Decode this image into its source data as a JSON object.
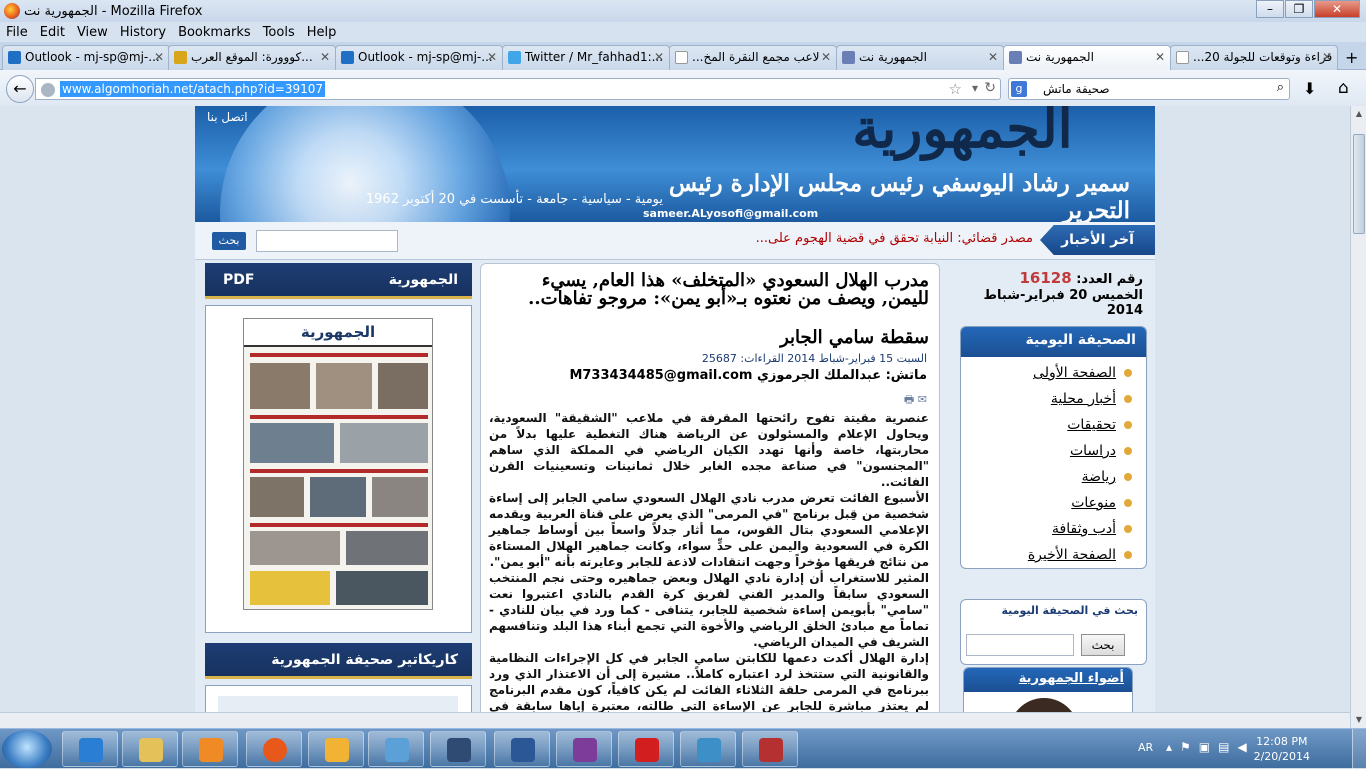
{
  "window": {
    "title": "الجمهورية نت - Mozilla Firefox"
  },
  "menu": [
    "File",
    "Edit",
    "View",
    "History",
    "Bookmarks",
    "Tools",
    "Help"
  ],
  "tabs": [
    {
      "label": "Outlook - mj-sp@mj-...",
      "icon_color": "#1f6fc5"
    },
    {
      "label": "كووورة: الموقع العرب...",
      "icon_color": "#d9a51b"
    },
    {
      "label": "Outlook - mj-sp@mj-...",
      "icon_color": "#1f6fc5"
    },
    {
      "label": "Twitter / Mr_fahhad1:...",
      "icon_color": "#41a6e8"
    },
    {
      "label": "...لاعب مجمع النقرة المخ",
      "icon_color": "#ffffff"
    },
    {
      "label": "الجمهورية نت",
      "icon_color": "#6a7fb5"
    },
    {
      "label": "الجمهورية نت",
      "icon_color": "#6a7fb5"
    },
    {
      "label": "...قراءة وتوقعات للجولة 20",
      "icon_color": "#ffffff"
    }
  ],
  "nav": {
    "url": "www.algomhoriah.net/atach.php?id=39107",
    "search_engine": "g",
    "search_query": "صحيفة ماتش"
  },
  "site": {
    "logo": "الجمهورية",
    "editor_line": "سمير رشاد اليوسفي رئيس مجلس الإدارة رئيس التحرير",
    "tagline": "يومية - سياسية - جامعة - تأسست في 20 أكتوبر 1962",
    "email": "sameer.ALyosofi@gmail.com",
    "contact": "اتصل بنا",
    "ticker_label": "آخر الأخبار",
    "ticker_text": "مصدر قضائي: النيابة تحقق في قضية الهجوم على...",
    "search_button": "بحث"
  },
  "left": {
    "pdf_title": "الجمهورية",
    "pdf_label": "PDF",
    "paper_masthead": "الجمهورية",
    "caricature_title": "كاريكاتير صحيفة الجمهورية"
  },
  "article": {
    "title": "مدرب الهلال السعودي «المتخلف» هذا العام, يسيء لليمن, ويصف من نعتوه بـ«أبو يمن»: مروجو تفاهات..",
    "subtitle": "سقطة سامي الجابر",
    "date_line": "السبت 15 فبراير-شباط 2014 القراءات: 25687",
    "author_label": "ماتش: عبدالملك الجرموزي",
    "author_email": "M733434485@gmail.com",
    "paragraphs": [
      "عنصرية مقيتة تفوح رائحتها المقرفة في ملاعب \"الشقيقة\" السعودية، ويحاول الإعلام والمسئولون عن الرياضة هناك التغطية عليها بدلاً من محاربتها، خاصة وأنها تهدد الكيان الرياضي في المملكة الذي ساهم \"المجنسون\" في صناعة مجده الغابر خلال ثمانينات وتسعينيات القرن الفائت..",
      "الأسبوع الفائت تعرض مدرب نادي الهلال السعودي سامي الجابر إلى إساءة شخصية من قِبل برنامج \"في المرمى\" الذي يعرض على قناة العربية ويقدمه الإعلامي السعودي بتال القوس، مما أثار جدلاً واسعاً بين أوساط جماهير الكرة في السعودية واليمن على حدٍّ سواء، وكانت جماهير الهلال المستاءة من نتائج فريقها مؤخراً وجهت انتقادات لاذعة للجابر وعايرته بأنه \"أبو يمن\".",
      "المثير للاستغراب أن إدارة نادي الهلال وبعض جماهيره وحتى نجم المنتخب السعودي سابقاً والمدير الفني لفريق كرة القدم بالنادي اعتبروا نعت \"سامي\" بأبويمن إساءة شخصية للجابر، يتنافى - كما ورد في بيان للنادي - تماماً مع مبادئ الخلق الرياضي والأخوة التي تجمع أبناء هذا البلد وتنافسهم الشريف في الميدان الرياضي.",
      "إدارة الهلال أكدت دعمها للكابتن سامي الجابر في كل الإجراءات النظامية والقانونية التي ستتخذ لرد اعتباره كاملاً.. مشيرة إلى أن الاعتذار الذي ورد ببرنامج في المرمى حلقة الثلاثاء الفائت لم يكن كافياً، كون مقدم البرنامج لم يعتذر مباشرة للجابر عن الإساءة التي طالته، معتبرة إياها سابقة في التعاطي الرياضي مع المنتسبين لأندية"
    ]
  },
  "right": {
    "issue_label": "رقم العدد:",
    "issue_number": "16128",
    "date": "الخميس 20 فبراير-شباط 2014",
    "daily_title": "الصحيفة اليومية",
    "daily_items": [
      "الصفحة الأولى",
      "أخبار محلية",
      "تحقيقات",
      "دراسات",
      "رياضة",
      "منوعات",
      "أدب وثقافة",
      "الصفحة الأخيرة"
    ],
    "search_title": "بحث في الصحيفة اليومية",
    "search_button": "بحث",
    "lights_title": "أضواء الجمهورية"
  },
  "taskbar": {
    "items": [
      {
        "name": "ie",
        "color": "#2a7fd4"
      },
      {
        "name": "explorer",
        "color": "#e5c15a"
      },
      {
        "name": "media-player",
        "color": "#f08a24"
      },
      {
        "name": "firefox",
        "color": "#e8581b"
      },
      {
        "name": "outlook",
        "color": "#f2b233"
      },
      {
        "name": "paint",
        "color": "#5ca0d8"
      },
      {
        "name": "media-center",
        "color": "#2f4b74"
      },
      {
        "name": "word",
        "color": "#2b5797"
      },
      {
        "name": "winrar",
        "color": "#7e3c9a"
      },
      {
        "name": "acrobat",
        "color": "#d21e1e"
      },
      {
        "name": "photo-viewer",
        "color": "#3c8fc7"
      },
      {
        "name": "pdf-app",
        "color": "#b53030"
      }
    ],
    "lang": "AR",
    "time": "12:08 PM",
    "date": "2/20/2014"
  }
}
